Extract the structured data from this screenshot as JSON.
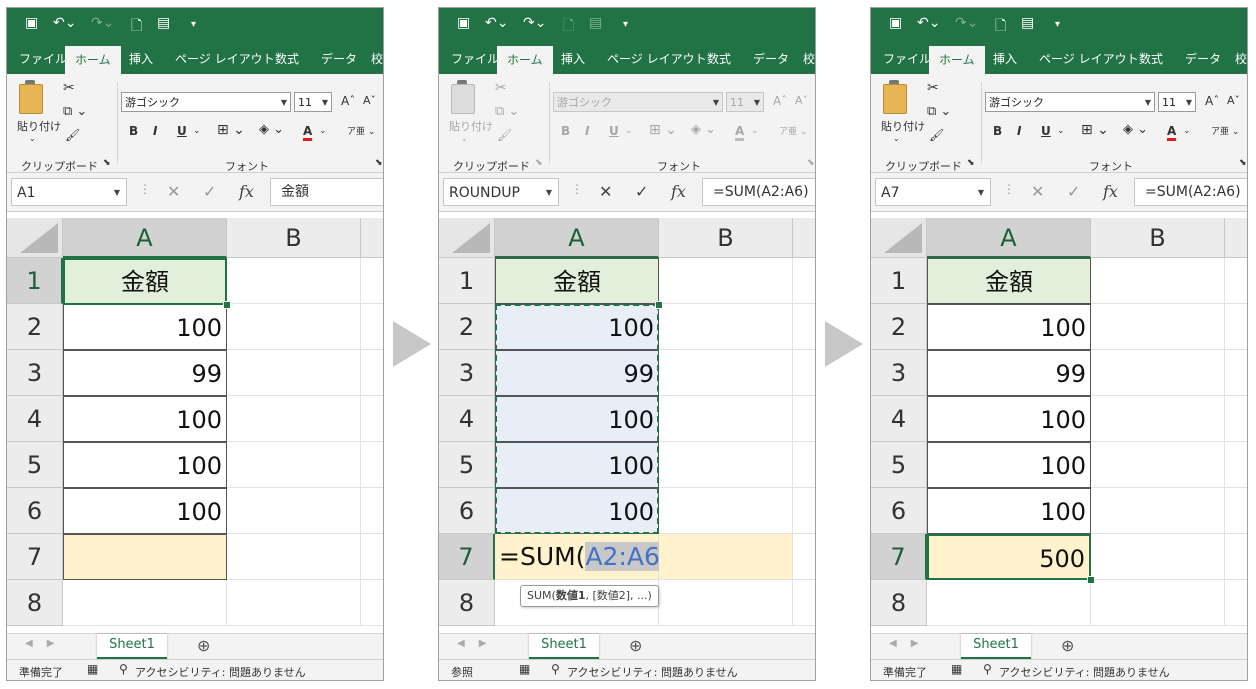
{
  "arrow_icon": "right-triangle-arrow",
  "colors": {
    "excel_green": "#217346",
    "header_fill": "#e2efda",
    "total_fill": "#fff2cc",
    "range_fill": "#e8eef8",
    "range_ref": "#4472c4"
  },
  "tabs": [
    "ファイル",
    "ホーム",
    "挿入",
    "ページ レイアウト",
    "数式",
    "データ",
    "校"
  ],
  "ribbon": {
    "paste_label": "貼り付け",
    "clipboard_label": "クリップボード",
    "font_label": "フォント",
    "font_name": "游ゴシック",
    "font_size": "11",
    "grow_font": "Aˆ",
    "shrink_font": "Aˇ",
    "bold": "B",
    "italic": "I",
    "underline": "U",
    "font_color": "A",
    "phonetic": "ア亜"
  },
  "fx_label": "fx",
  "sheet_tab": "Sheet1",
  "add_sheet": "⊕",
  "accessibility": "アクセシビリティ: 問題ありません",
  "columns": [
    "A",
    "B"
  ],
  "rows": [
    "1",
    "2",
    "3",
    "4",
    "5",
    "6",
    "7",
    "8"
  ],
  "panels": [
    {
      "name_box": "A1",
      "formula_bar": "金額",
      "status_mode": "準備完了",
      "cells": {
        "A1": "金額",
        "A2": "100",
        "A3": "99",
        "A4": "100",
        "A5": "100",
        "A6": "100",
        "A7": ""
      }
    },
    {
      "name_box": "ROUNDUP",
      "formula_bar": "=SUM(A2:A6)",
      "status_mode": "参照",
      "cells": {
        "A1": "金額",
        "A2": "100",
        "A3": "99",
        "A4": "100",
        "A5": "100",
        "A6": "100"
      },
      "edit_formula": {
        "prefix": "=SUM(",
        "ref": "A2:A6",
        "suffix": ")"
      },
      "tooltip": {
        "func": "SUM(",
        "arg1": "数値1",
        "rest": ", [数値2], ...)"
      }
    },
    {
      "name_box": "A7",
      "formula_bar": "=SUM(A2:A6)",
      "status_mode": "準備完了",
      "cells": {
        "A1": "金額",
        "A2": "100",
        "A3": "99",
        "A4": "100",
        "A5": "100",
        "A6": "100",
        "A7": "500"
      }
    }
  ]
}
